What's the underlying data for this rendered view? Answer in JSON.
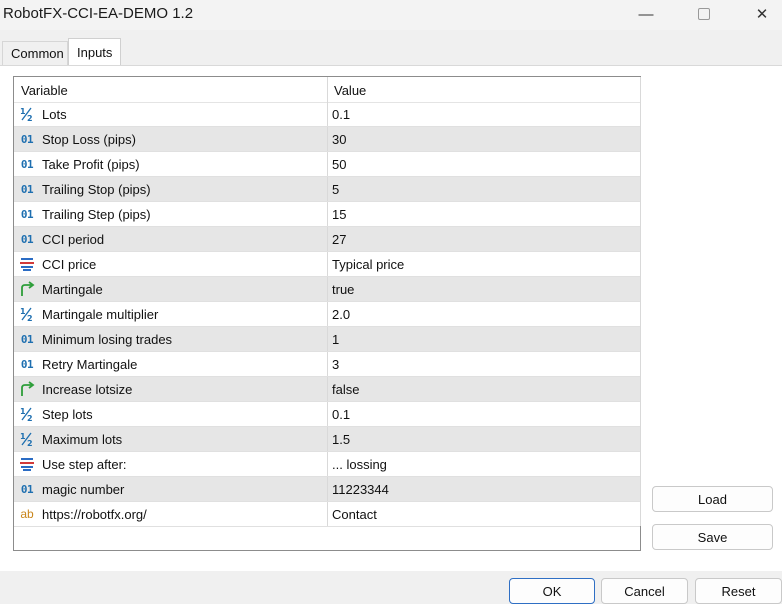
{
  "window": {
    "title": "RobotFX-CCI-EA-DEMO 1.2"
  },
  "tabs": [
    {
      "label": "Common"
    },
    {
      "label": "Inputs"
    }
  ],
  "table": {
    "headers": {
      "variable": "Variable",
      "value": "Value"
    },
    "rows": [
      {
        "icon": "fraction-icon",
        "name": "Lots",
        "value": "0.1"
      },
      {
        "icon": "integer-icon",
        "name": "Stop Loss (pips)",
        "value": "30"
      },
      {
        "icon": "integer-icon",
        "name": "Take Profit (pips)",
        "value": "50"
      },
      {
        "icon": "integer-icon",
        "name": "Trailing Stop (pips)",
        "value": "5"
      },
      {
        "icon": "integer-icon",
        "name": "Trailing Step (pips)",
        "value": "15"
      },
      {
        "icon": "integer-icon",
        "name": "CCI period",
        "value": "27"
      },
      {
        "icon": "enum-icon",
        "name": "CCI price",
        "value": "Typical price"
      },
      {
        "icon": "bool-icon",
        "name": "Martingale",
        "value": "true"
      },
      {
        "icon": "fraction-icon",
        "name": "Martingale multiplier",
        "value": "2.0"
      },
      {
        "icon": "integer-icon",
        "name": "Minimum losing trades",
        "value": "1"
      },
      {
        "icon": "integer-icon",
        "name": "Retry Martingale",
        "value": "3"
      },
      {
        "icon": "bool-icon",
        "name": "Increase lotsize",
        "value": "false"
      },
      {
        "icon": "fraction-icon",
        "name": "Step lots",
        "value": "0.1"
      },
      {
        "icon": "fraction-icon",
        "name": "Maximum lots",
        "value": "1.5"
      },
      {
        "icon": "enum-icon",
        "name": "Use step after:",
        "value": "... lossing"
      },
      {
        "icon": "integer-icon",
        "name": "magic number",
        "value": "11223344"
      },
      {
        "icon": "string-icon",
        "name": "https://robotfx.org/",
        "value": "Contact"
      }
    ]
  },
  "side_buttons": {
    "load": "Load",
    "save": "Save"
  },
  "footer_buttons": {
    "ok": "OK",
    "cancel": "Cancel",
    "reset": "Reset"
  },
  "colors": {
    "accent": "#2f6fc4",
    "int_icon": "#1e6fb0",
    "bool_icon": "#2e9e3a",
    "string_icon": "#c9861c",
    "enum_icon_red": "#d23a3a",
    "enum_icon_blue": "#2b6cc4"
  }
}
